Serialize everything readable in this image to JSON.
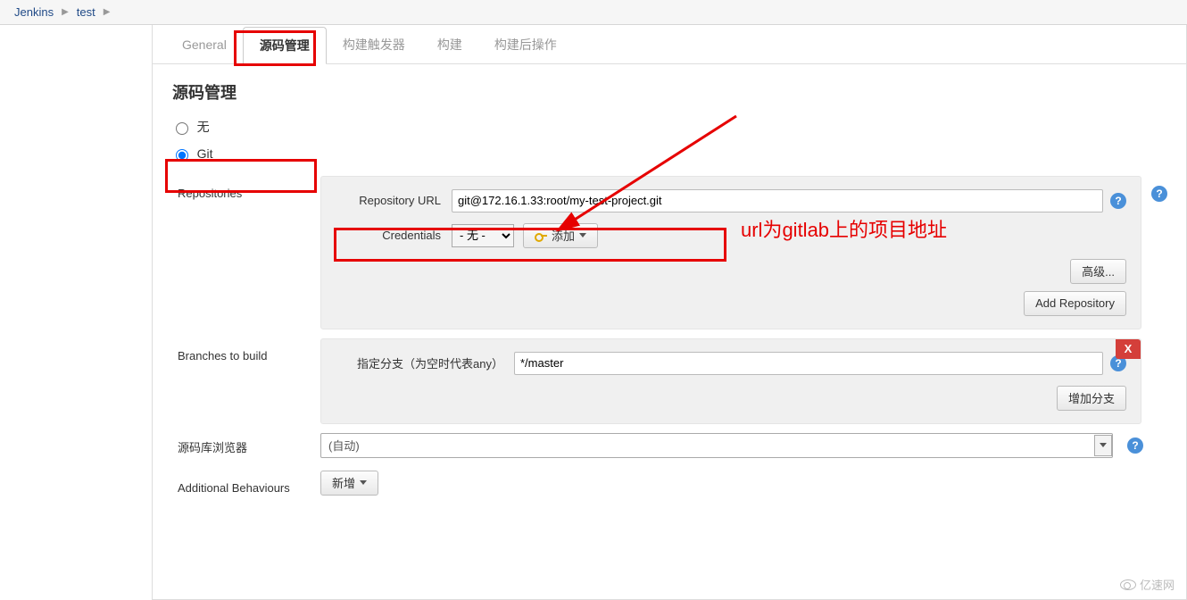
{
  "breadcrumb": {
    "root": "Jenkins",
    "job": "test"
  },
  "tabs": {
    "general": "General",
    "scm": "源码管理",
    "triggers": "构建触发器",
    "build": "构建",
    "postbuild": "构建后操作"
  },
  "section_title": "源码管理",
  "scm_options": {
    "none": "无",
    "git": "Git"
  },
  "repos": {
    "label": "Repositories",
    "url_label": "Repository URL",
    "url_value": "git@172.16.1.33:root/my-test-project.git",
    "cred_label": "Credentials",
    "cred_none": "- 无 -",
    "add_btn": "添加",
    "advanced": "高级...",
    "add_repo": "Add Repository"
  },
  "branches": {
    "label": "Branches to build",
    "spec_label": "指定分支（为空时代表any）",
    "spec_value": "*/master",
    "add_branch": "增加分支",
    "close": "X"
  },
  "browser": {
    "label": "源码库浏览器",
    "value": "(自动)"
  },
  "additional": {
    "label": "Additional Behaviours",
    "add_btn": "新增"
  },
  "annotation": "url为gitlab上的项目地址",
  "watermark": "亿速网"
}
